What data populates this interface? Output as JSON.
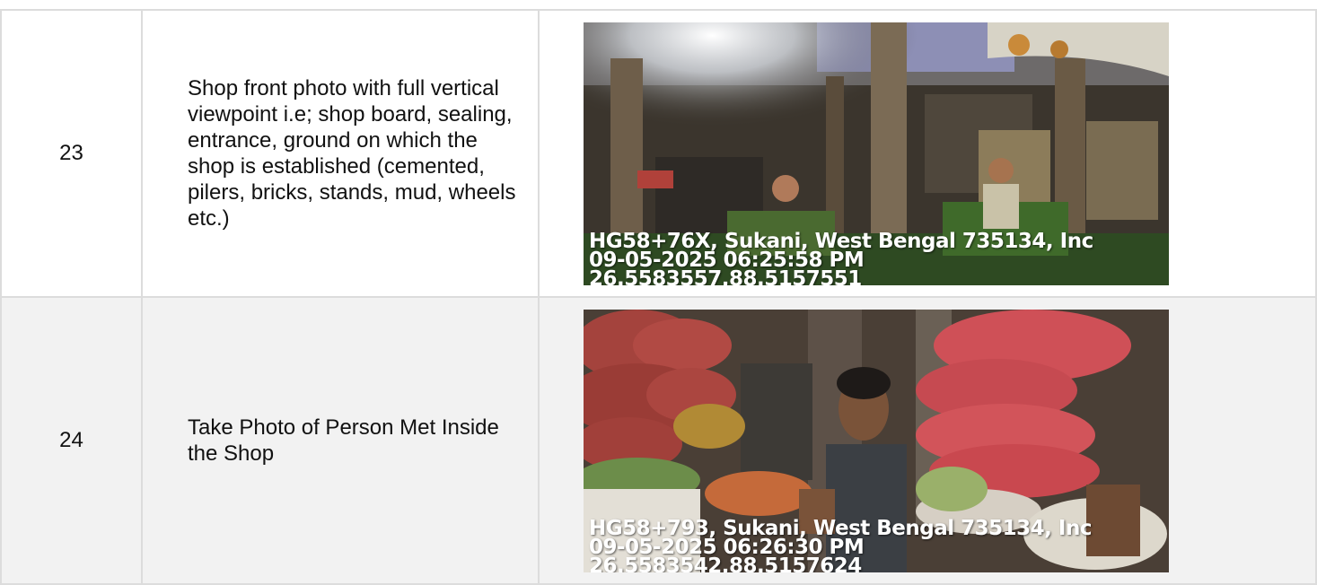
{
  "rows": [
    {
      "number": "23",
      "description": "Shop front photo with full vertical viewpoint i.e; shop board, sealing, entrance, ground on which the shop is established (cemented, pilers, bricks, stands, mud, wheels etc.)",
      "photo": {
        "address": "HG58+76X, Sukani, West Bengal 735134, Inc",
        "datetime": "09-05-2025 06:25:58 PM",
        "coordinates": "26.5583557,88.5157551"
      }
    },
    {
      "number": "24",
      "description": "Take Photo of Person Met Inside the Shop",
      "photo": {
        "address": "HG58+793, Sukani, West Bengal 735134, Inc",
        "datetime": "09-05-2025 06:26:30 PM",
        "coordinates": "26.5583542,88.5157624"
      }
    }
  ],
  "colors": {
    "border": "#dcdcdc",
    "alt_row": "#f2f2f2",
    "overlay_text": "#ffffff"
  }
}
